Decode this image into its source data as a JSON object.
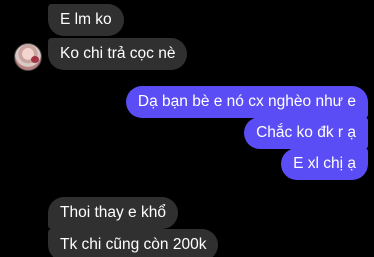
{
  "conversation": {
    "messages": [
      {
        "direction": "incoming",
        "text": "E lm ko"
      },
      {
        "direction": "incoming",
        "text": "Ko chi trả cọc nè"
      },
      {
        "direction": "outgoing",
        "text": "Dạ bạn bè e nó cx nghèo như e"
      },
      {
        "direction": "outgoing",
        "text": "Chắc ko đk r ạ"
      },
      {
        "direction": "outgoing",
        "text": "E xl chị ạ"
      },
      {
        "direction": "incoming",
        "text": "Thoi thay e khổ"
      },
      {
        "direction": "incoming",
        "text": "Tk chi cũng còn 200k"
      }
    ]
  },
  "colors": {
    "background": "#000000",
    "incoming_bubble": "#303030",
    "outgoing_bubble": "#5b4df5",
    "text": "#ffffff"
  },
  "icons": {
    "sender_avatar": "contact-avatar-icon"
  }
}
